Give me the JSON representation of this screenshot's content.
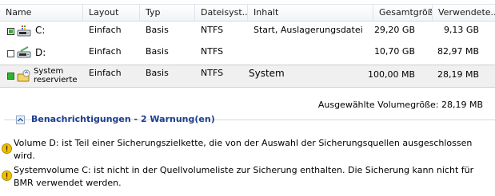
{
  "columns": [
    "Name",
    "Layout",
    "Typ",
    "Dateisyst...",
    "Inhalt",
    "Gesamtgröße",
    "Verwendete..."
  ],
  "rows": [
    {
      "name": "C:",
      "layout": "Einfach",
      "typ": "Basis",
      "fs": "NTFS",
      "inhalt": "Start, Auslagerungsdatei",
      "total": "29,20 GB",
      "used": "9,13 GB",
      "checkbox": "partial",
      "icon": "system-drive-icon"
    },
    {
      "name": "D:",
      "layout": "Einfach",
      "typ": "Basis",
      "fs": "NTFS",
      "inhalt": "",
      "total": "10,70 GB",
      "used": "82,97 MB",
      "checkbox": "unchecked",
      "icon": "drive-icon"
    },
    {
      "name1": "System",
      "name2": "reservierte",
      "layout": "Einfach",
      "typ": "Basis",
      "fs": "NTFS",
      "inhalt": "System",
      "total": "100,00 MB",
      "used": "28,19 MB",
      "checkbox": "checked",
      "icon": "reserved-volume-icon"
    }
  ],
  "summary": "Ausgewählte Volumegröße: 28,19 MB",
  "notifications": {
    "title": "Benachrichtigungen - 2 Warnung(en)",
    "items": [
      {
        "line1": "Volume D: ist Teil einer Sicherungszielkette, die von der Auswahl der Sicherungsquellen ausgeschlossen",
        "line2": "wird."
      },
      {
        "line1": "Systemvolume C: ist nicht in der Quellvolumeliste zur Sicherung enthalten. Die Sicherung kann nicht für",
        "line2": "BMR verwendet werden."
      }
    ]
  },
  "colors": {
    "accent": "#1f3f8f",
    "checked": "#2bb52b",
    "warning": "#f2c200"
  }
}
